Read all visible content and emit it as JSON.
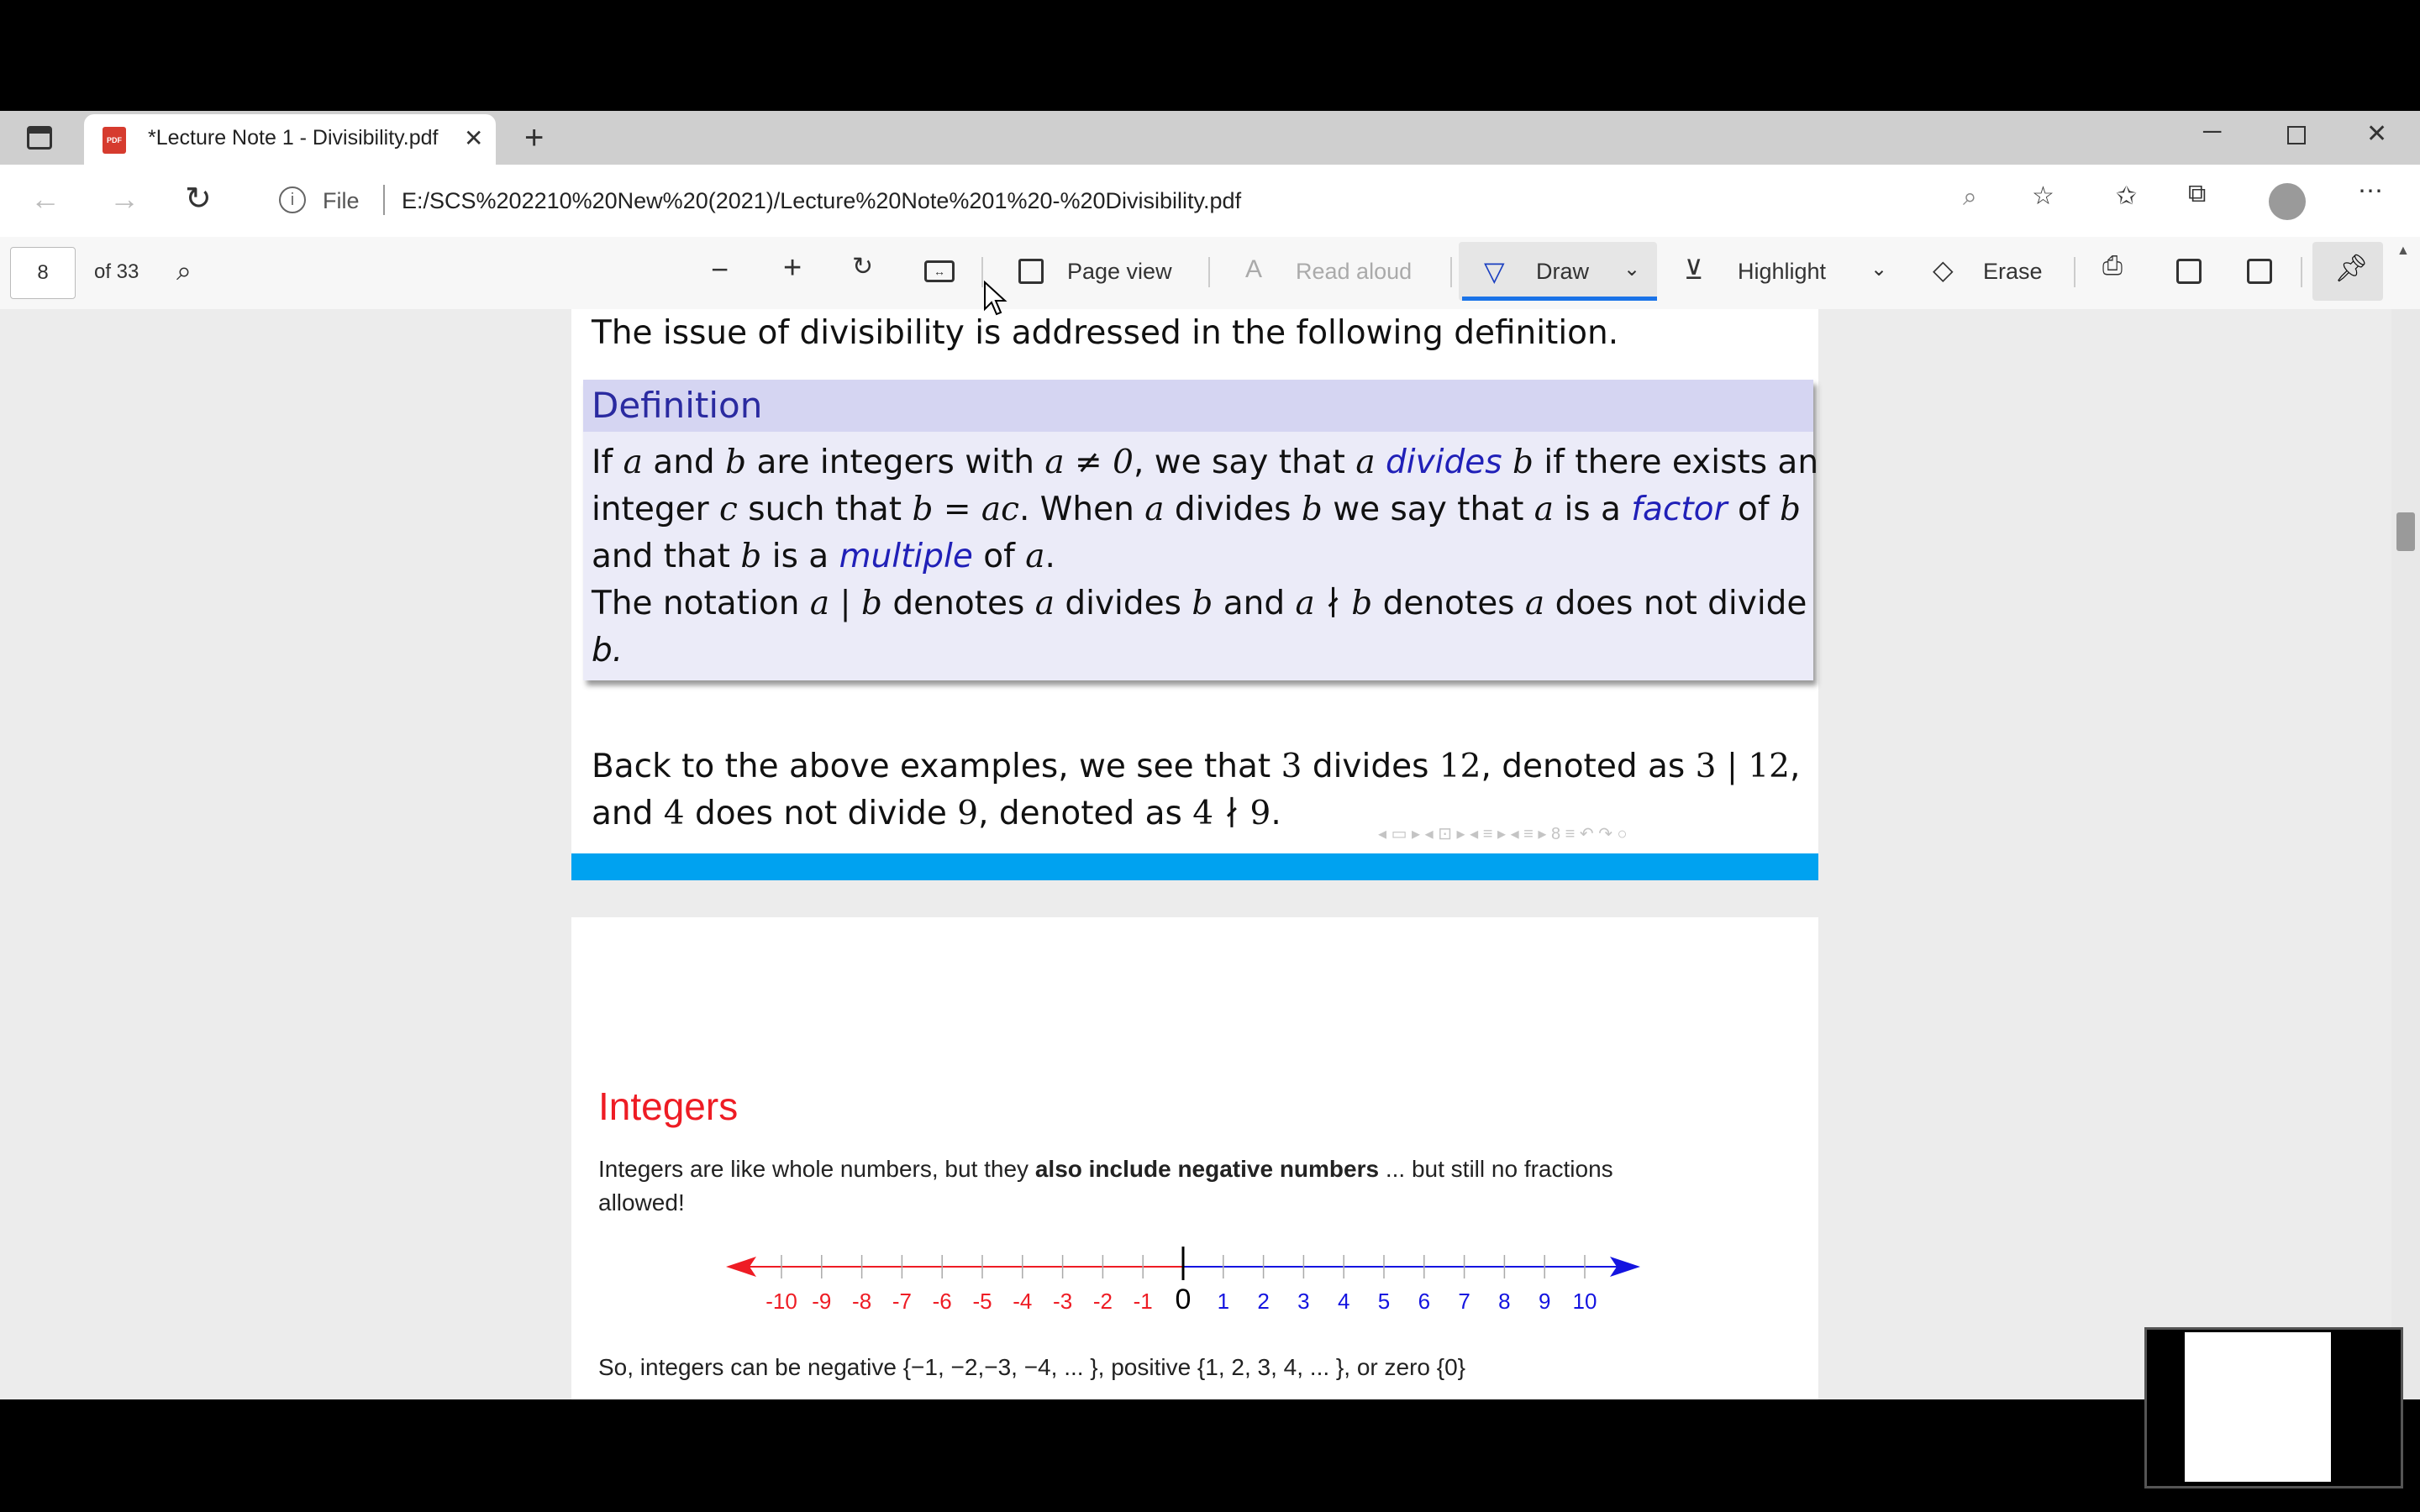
{
  "browser": {
    "tab_title": "*Lecture Note 1 - Divisibility.pdf",
    "file_label": "File",
    "url": "E:/SCS%202210%20New%20(2021)/Lecture%20Note%201%20-%20Divisibility.pdf"
  },
  "pdf_toolbar": {
    "page_number": "8",
    "page_total": "of 33",
    "page_view": "Page view",
    "read_aloud": "Read aloud",
    "draw": "Draw",
    "highlight": "Highlight",
    "erase": "Erase"
  },
  "page8": {
    "intro": "The issue of divisibility is addressed in the following definition.",
    "definition_title": "Definition",
    "def_line1": {
      "a": "If ",
      "b": "a",
      "c": " and ",
      "d": "b",
      "e": " are integers with ",
      "f": "a ≠ 0",
      "g": ", we say that ",
      "h": "a",
      "i": "divides",
      "j": "b",
      "k": " if there exists an"
    },
    "def_line2": {
      "a": "integer ",
      "b": "c",
      "c": " such that ",
      "d": "b = ac",
      "e": ". When ",
      "f": "a",
      "g": " divides ",
      "h": "b",
      "i": " we say that ",
      "j": "a",
      "k": " is a ",
      "l": "factor",
      "m": " of ",
      "n": "b"
    },
    "def_line3": {
      "a": "and that ",
      "b": "b",
      "c": " is a ",
      "d": "multiple",
      "e": " of ",
      "f": "a",
      "g": "."
    },
    "def_line4": {
      "a": "The notation ",
      "b": "a | b",
      "c": " denotes ",
      "d": "a",
      "e": " divides ",
      "f": "b",
      "g": " and ",
      "h": "a ∤ b",
      "i": " denotes ",
      "j": "a",
      "k": " does not divide"
    },
    "def_line5": "b.",
    "back_line1": {
      "a": "Back to the above examples, we see that ",
      "b": "3",
      "c": " divides ",
      "d": "12",
      "e": ", denoted as ",
      "f": "3 | 12",
      "g": ","
    },
    "back_line2": {
      "a": "and ",
      "b": "4",
      "c": " does not divide ",
      "d": "9",
      "e": ", denoted as ",
      "f": "4 ∤ 9",
      "g": "."
    },
    "nav_symbols": "◂ ▭ ▸  ◂ ⊡ ▸  ◂ ≡ ▸  ◂ ≡ ▸    8 ≡   ↶ ↷ ○"
  },
  "page9": {
    "title": "Integers",
    "intro_part1": "Integers are like whole numbers, but they ",
    "intro_bold": "also include negative numbers",
    "intro_part2": " ... but still no fractions",
    "intro_line2": "allowed!",
    "numberline_labels": [
      "-10",
      "-9",
      "-8",
      "-7",
      "-6",
      "-5",
      "-4",
      "-3",
      "-2",
      "-1",
      "0",
      "1",
      "2",
      "3",
      "4",
      "5",
      "6",
      "7",
      "8",
      "9",
      "10"
    ],
    "summary": "So, integers can be negative {−1, −2,−3, −4, ... }, positive {1, 2, 3, 4, ... }, or zero {0}"
  },
  "colors": {
    "negative": "#ee1c24",
    "positive": "#1414e0",
    "accent": "#00a2f0"
  }
}
